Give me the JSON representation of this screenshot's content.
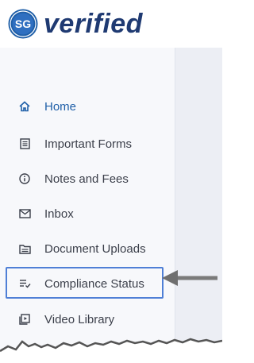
{
  "brand": {
    "logo_mark": "SG",
    "name": "verified"
  },
  "sidebar": {
    "items": [
      {
        "label": "Home",
        "icon": "home-icon",
        "active": true
      },
      {
        "label": "Important Forms",
        "icon": "forms-icon"
      },
      {
        "label": "Notes and Fees",
        "icon": "info-icon"
      },
      {
        "label": "Inbox",
        "icon": "mail-icon"
      },
      {
        "label": "Document Uploads",
        "icon": "folder-icon"
      },
      {
        "label": "Compliance Status",
        "icon": "checklist-icon"
      },
      {
        "label": "Video Library",
        "icon": "video-icon"
      }
    ]
  },
  "colors": {
    "accent": "#1f5fa8",
    "brand": "#1f3a72",
    "highlight": "#4f7fd6",
    "arrow": "#7a7a7a"
  }
}
